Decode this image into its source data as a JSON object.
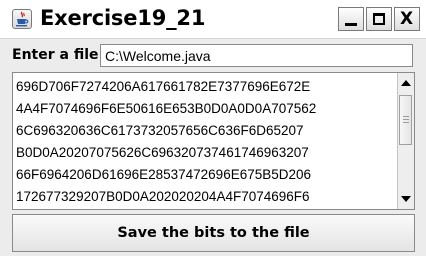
{
  "window": {
    "title": "Exercise19_21",
    "minimize_glyph": "",
    "close_glyph": "X"
  },
  "file_row": {
    "label": "Enter a file",
    "value": "C:\\Welcome.java"
  },
  "hex_output": {
    "lines": [
      "696D706F7274206A617661782E7377696E672E",
      "4A4F7074696F6E50616E653B0D0A0D0A707562",
      "6C696320636C6173732057656C636F6D65207",
      "B0D0A20207075626C696320737461746963207",
      "66F6964206D61696E28537472696E675B5D206",
      "172677329207B0D0A202020204A4F7074696F6"
    ]
  },
  "save_button": {
    "label": "Save the bits to the file"
  }
}
